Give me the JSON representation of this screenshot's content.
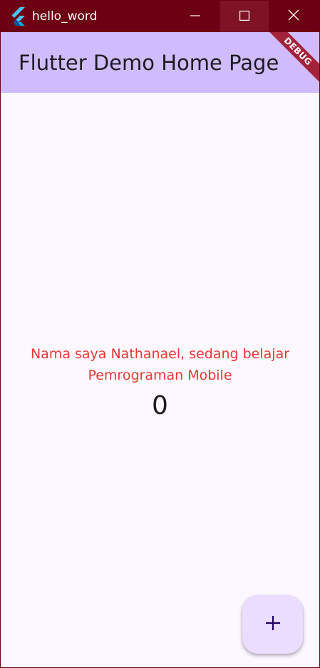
{
  "window": {
    "title": "hello_word",
    "titlebar_color": "#6e0014",
    "controls": {
      "minimize_icon": "minimize-icon",
      "maximize_icon": "maximize-icon",
      "close_icon": "close-icon"
    }
  },
  "appbar": {
    "title": "Flutter Demo Home Page",
    "background": "#d0bcfd",
    "debug_banner": "DEBUG"
  },
  "main": {
    "message": "Nama saya Nathanael, sedang belajar Pemrograman Mobile",
    "message_color": "#e53935",
    "counter": "0"
  },
  "fab": {
    "icon": "plus-icon",
    "background": "#eaddff"
  }
}
